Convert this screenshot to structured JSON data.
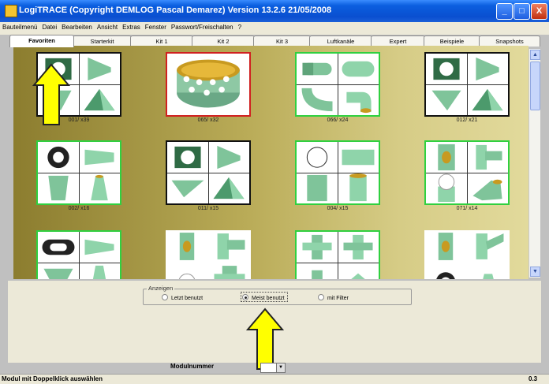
{
  "window": {
    "title": "LogiTRACE  (Copyright DEMLOG Pascal Demarez)  Version 13.2.6  21/05/2008",
    "minimize": "_",
    "maximize": "□",
    "close": "X"
  },
  "menu": [
    "Bauteilmenü",
    "Datei",
    "Bearbeiten",
    "Ansicht",
    "Extras",
    "Fenster",
    "Passwort/Freischalten",
    "?"
  ],
  "tabs": [
    {
      "label": "Favoriten",
      "active": true
    },
    {
      "label": "Starterkit"
    },
    {
      "label": "Kit 1"
    },
    {
      "label": "Kit 2"
    },
    {
      "label": "Kit 3"
    },
    {
      "label": "Luftkanäle"
    },
    {
      "label": "Expert"
    },
    {
      "label": "Beispiele"
    },
    {
      "label": "Snapshots"
    }
  ],
  "modules": [
    {
      "caption": "001/ x39",
      "border": "black"
    },
    {
      "caption": "065/ x32",
      "border": "red"
    },
    {
      "caption": "066/ x24",
      "border": "green"
    },
    {
      "caption": "012/ x21",
      "border": "black"
    },
    {
      "caption": "002/ x16",
      "border": "green"
    },
    {
      "caption": "011/ x15",
      "border": "black"
    },
    {
      "caption": "004/ x15",
      "border": "green"
    },
    {
      "caption": "071/ x14",
      "border": "green"
    },
    {
      "caption": "",
      "border": "green"
    },
    {
      "caption": "",
      "border": "none"
    },
    {
      "caption": "",
      "border": "green"
    },
    {
      "caption": "",
      "border": "none"
    }
  ],
  "anzeigen": {
    "group_label": "Anzeigen",
    "options": [
      {
        "label": "Letzt benutzt",
        "selected": false
      },
      {
        "label": "Meist benutzt",
        "selected": true
      },
      {
        "label": "mit Filter",
        "selected": false
      }
    ]
  },
  "modulnummer": {
    "label": "Modulnummer",
    "value": ""
  },
  "status": {
    "text": "Modul mit Doppelklick auswählen",
    "version": "0.3"
  },
  "colors": {
    "accent_highlight": "#ffff00",
    "shape": "#7fc49a",
    "frame_green": "#30d040",
    "frame_red": "#d02020"
  }
}
